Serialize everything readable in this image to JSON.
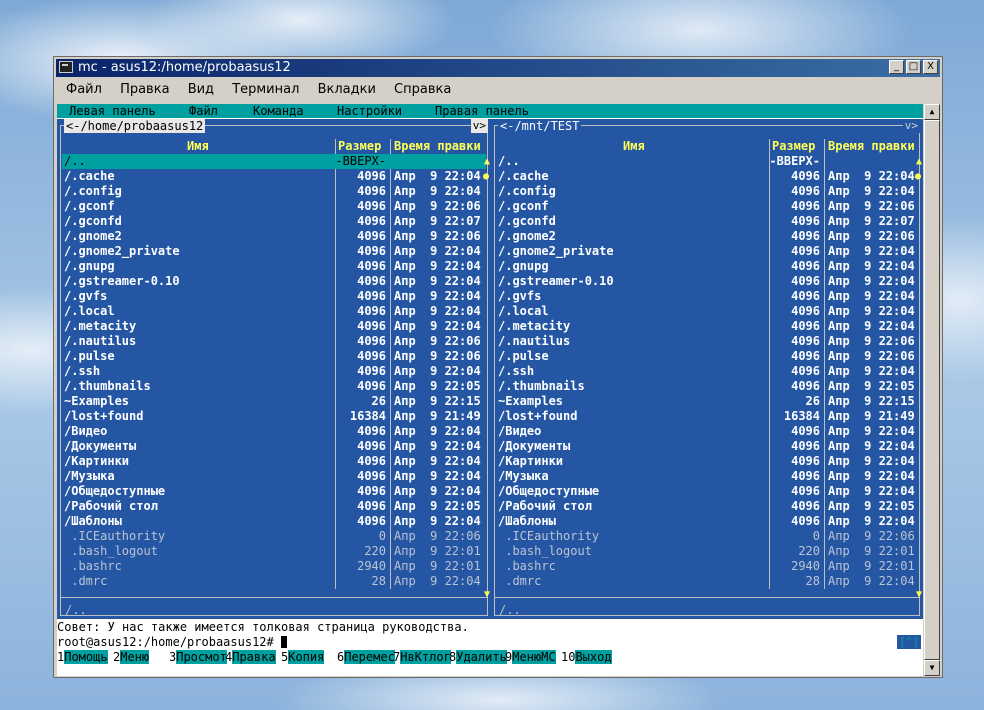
{
  "window": {
    "title": "mc - asus12:/home/probaasus12",
    "controls": [
      "_",
      "□",
      "X"
    ]
  },
  "menubar": [
    "Файл",
    "Правка",
    "Вид",
    "Терминал",
    "Вкладки",
    "Справка"
  ],
  "mc_menu": [
    "Левая панель",
    "Файл",
    "Команда",
    "Настройки",
    "Правая панель"
  ],
  "left_panel": {
    "path": "<-/home/probaasus12",
    "corner": "v>",
    "col_name": "Имя",
    "col_size": "Размер",
    "col_time": "Время правки",
    "mini": "/..",
    "rows": [
      {
        "name": "/..",
        "size": "-ВВЕРХ-",
        "time": "",
        "kind": "sel"
      },
      {
        "name": "/.cache",
        "size": "4096",
        "time": "Апр  9 22:04",
        "kind": "dir"
      },
      {
        "name": "/.config",
        "size": "4096",
        "time": "Апр  9 22:04",
        "kind": "dir"
      },
      {
        "name": "/.gconf",
        "size": "4096",
        "time": "Апр  9 22:06",
        "kind": "dir"
      },
      {
        "name": "/.gconfd",
        "size": "4096",
        "time": "Апр  9 22:07",
        "kind": "dir"
      },
      {
        "name": "/.gnome2",
        "size": "4096",
        "time": "Апр  9 22:06",
        "kind": "dir"
      },
      {
        "name": "/.gnome2_private",
        "size": "4096",
        "time": "Апр  9 22:04",
        "kind": "dir"
      },
      {
        "name": "/.gnupg",
        "size": "4096",
        "time": "Апр  9 22:04",
        "kind": "dir"
      },
      {
        "name": "/.gstreamer-0.10",
        "size": "4096",
        "time": "Апр  9 22:04",
        "kind": "dir"
      },
      {
        "name": "/.gvfs",
        "size": "4096",
        "time": "Апр  9 22:04",
        "kind": "dir"
      },
      {
        "name": "/.local",
        "size": "4096",
        "time": "Апр  9 22:04",
        "kind": "dir"
      },
      {
        "name": "/.metacity",
        "size": "4096",
        "time": "Апр  9 22:04",
        "kind": "dir"
      },
      {
        "name": "/.nautilus",
        "size": "4096",
        "time": "Апр  9 22:06",
        "kind": "dir"
      },
      {
        "name": "/.pulse",
        "size": "4096",
        "time": "Апр  9 22:06",
        "kind": "dir"
      },
      {
        "name": "/.ssh",
        "size": "4096",
        "time": "Апр  9 22:04",
        "kind": "dir"
      },
      {
        "name": "/.thumbnails",
        "size": "4096",
        "time": "Апр  9 22:05",
        "kind": "dir"
      },
      {
        "name": "~Examples",
        "size": "26",
        "time": "Апр  9 22:15",
        "kind": "dir"
      },
      {
        "name": "/lost+found",
        "size": "16384",
        "time": "Апр  9 21:49",
        "kind": "dir"
      },
      {
        "name": "/Видео",
        "size": "4096",
        "time": "Апр  9 22:04",
        "kind": "dir"
      },
      {
        "name": "/Документы",
        "size": "4096",
        "time": "Апр  9 22:04",
        "kind": "dir"
      },
      {
        "name": "/Картинки",
        "size": "4096",
        "time": "Апр  9 22:04",
        "kind": "dir"
      },
      {
        "name": "/Музыка",
        "size": "4096",
        "time": "Апр  9 22:04",
        "kind": "dir"
      },
      {
        "name": "/Общедоступные",
        "size": "4096",
        "time": "Апр  9 22:04",
        "kind": "dir"
      },
      {
        "name": "/Рабочий стол",
        "size": "4096",
        "time": "Апр  9 22:05",
        "kind": "dir"
      },
      {
        "name": "/Шаблоны",
        "size": "4096",
        "time": "Апр  9 22:04",
        "kind": "dir"
      },
      {
        "name": " .ICEauthority",
        "size": "0",
        "time": "Апр  9 22:06",
        "kind": "file"
      },
      {
        "name": " .bash_logout",
        "size": "220",
        "time": "Апр  9 22:01",
        "kind": "file"
      },
      {
        "name": " .bashrc",
        "size": "2940",
        "time": "Апр  9 22:01",
        "kind": "file"
      },
      {
        "name": " .dmrc",
        "size": "28",
        "time": "Апр  9 22:04",
        "kind": "file"
      }
    ]
  },
  "right_panel": {
    "path": "<-/mnt/TEST",
    "corner": "v>",
    "col_name": "Имя",
    "col_size": "Размер",
    "col_time": "Время правки",
    "mini": "/..",
    "rows": [
      {
        "name": "/..",
        "size": "-ВВЕРХ-",
        "time": "",
        "kind": "dir"
      },
      {
        "name": "/.cache",
        "size": "4096",
        "time": "Апр  9 22:04",
        "kind": "dir"
      },
      {
        "name": "/.config",
        "size": "4096",
        "time": "Апр  9 22:04",
        "kind": "dir"
      },
      {
        "name": "/.gconf",
        "size": "4096",
        "time": "Апр  9 22:06",
        "kind": "dir"
      },
      {
        "name": "/.gconfd",
        "size": "4096",
        "time": "Апр  9 22:07",
        "kind": "dir"
      },
      {
        "name": "/.gnome2",
        "size": "4096",
        "time": "Апр  9 22:06",
        "kind": "dir"
      },
      {
        "name": "/.gnome2_private",
        "size": "4096",
        "time": "Апр  9 22:04",
        "kind": "dir"
      },
      {
        "name": "/.gnupg",
        "size": "4096",
        "time": "Апр  9 22:04",
        "kind": "dir"
      },
      {
        "name": "/.gstreamer-0.10",
        "size": "4096",
        "time": "Апр  9 22:04",
        "kind": "dir"
      },
      {
        "name": "/.gvfs",
        "size": "4096",
        "time": "Апр  9 22:04",
        "kind": "dir"
      },
      {
        "name": "/.local",
        "size": "4096",
        "time": "Апр  9 22:04",
        "kind": "dir"
      },
      {
        "name": "/.metacity",
        "size": "4096",
        "time": "Апр  9 22:04",
        "kind": "dir"
      },
      {
        "name": "/.nautilus",
        "size": "4096",
        "time": "Апр  9 22:06",
        "kind": "dir"
      },
      {
        "name": "/.pulse",
        "size": "4096",
        "time": "Апр  9 22:06",
        "kind": "dir"
      },
      {
        "name": "/.ssh",
        "size": "4096",
        "time": "Апр  9 22:04",
        "kind": "dir"
      },
      {
        "name": "/.thumbnails",
        "size": "4096",
        "time": "Апр  9 22:05",
        "kind": "dir"
      },
      {
        "name": "~Examples",
        "size": "26",
        "time": "Апр  9 22:15",
        "kind": "dir"
      },
      {
        "name": "/lost+found",
        "size": "16384",
        "time": "Апр  9 21:49",
        "kind": "dir"
      },
      {
        "name": "/Видео",
        "size": "4096",
        "time": "Апр  9 22:04",
        "kind": "dir"
      },
      {
        "name": "/Документы",
        "size": "4096",
        "time": "Апр  9 22:04",
        "kind": "dir"
      },
      {
        "name": "/Картинки",
        "size": "4096",
        "time": "Апр  9 22:04",
        "kind": "dir"
      },
      {
        "name": "/Музыка",
        "size": "4096",
        "time": "Апр  9 22:04",
        "kind": "dir"
      },
      {
        "name": "/Общедоступные",
        "size": "4096",
        "time": "Апр  9 22:04",
        "kind": "dir"
      },
      {
        "name": "/Рабочий стол",
        "size": "4096",
        "time": "Апр  9 22:05",
        "kind": "dir"
      },
      {
        "name": "/Шаблоны",
        "size": "4096",
        "time": "Апр  9 22:04",
        "kind": "dir"
      },
      {
        "name": " .ICEauthority",
        "size": "0",
        "time": "Апр  9 22:06",
        "kind": "file"
      },
      {
        "name": " .bash_logout",
        "size": "220",
        "time": "Апр  9 22:01",
        "kind": "file"
      },
      {
        "name": " .bashrc",
        "size": "2940",
        "time": "Апр  9 22:01",
        "kind": "file"
      },
      {
        "name": " .dmrc",
        "size": "28",
        "time": "Апр  9 22:04",
        "kind": "file"
      }
    ]
  },
  "hint": "Совет: У нас также имеется толковая страница руководства.",
  "prompt": "root@asus12:/home/probaasus12# ",
  "history_button": "[^]",
  "fkeys": [
    {
      "num": "1",
      "label": "Помощь"
    },
    {
      "num": "2",
      "label": "Меню"
    },
    {
      "num": "3",
      "label": "Просмот"
    },
    {
      "num": "4",
      "label": "Правка"
    },
    {
      "num": "5",
      "label": "Копия"
    },
    {
      "num": "6",
      "label": "Перемес"
    },
    {
      "num": "7",
      "label": "НвКтлог"
    },
    {
      "num": "8",
      "label": "Удалить"
    },
    {
      "num": "9",
      "label": "МенюМС"
    },
    {
      "num": "10",
      "label": "Выход"
    }
  ],
  "colors": {
    "panel_bg": "#2456a4",
    "cyan": "#00a0a0",
    "header_yellow": "#ffff55"
  }
}
